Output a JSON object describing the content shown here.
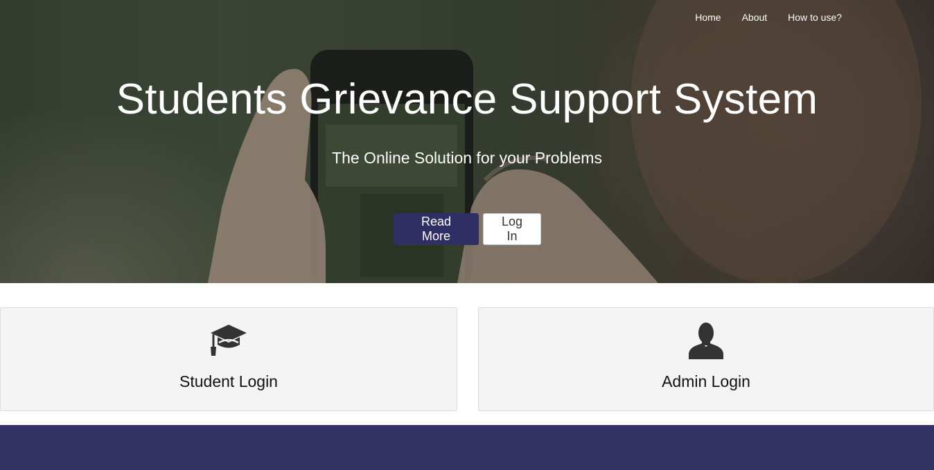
{
  "nav": {
    "items": [
      {
        "label": "Home"
      },
      {
        "label": "About"
      },
      {
        "label": "How to use?"
      }
    ]
  },
  "hero": {
    "title": "Students Grievance Support System",
    "subtitle": "The Online Solution for your Problems",
    "primary_button": "Read More",
    "secondary_button": "Log In"
  },
  "cards": {
    "student": {
      "label": "Student Login",
      "icon": "graduation-cap-icon"
    },
    "admin": {
      "label": "Admin Login",
      "icon": "user-icon"
    }
  },
  "colors": {
    "brand": "#333366",
    "card_bg": "#f4f4f4",
    "icon": "#333333"
  }
}
